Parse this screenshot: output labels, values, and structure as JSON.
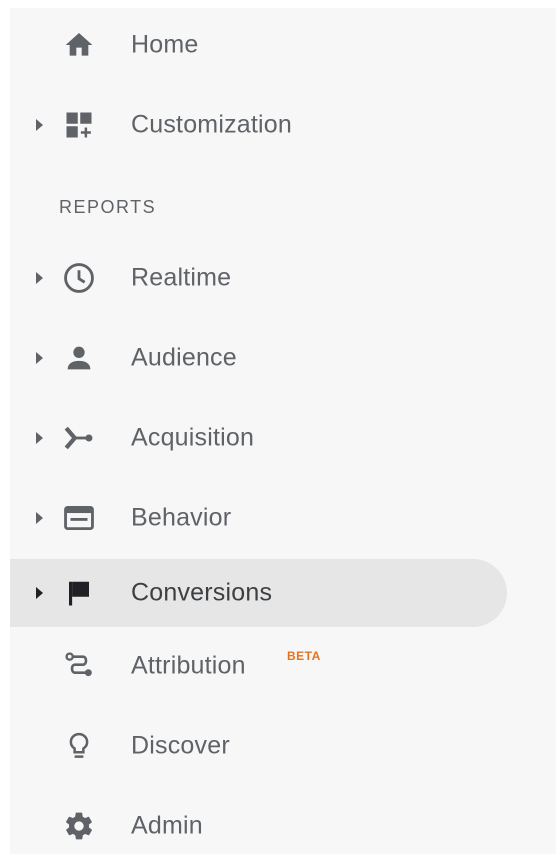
{
  "nav": {
    "home": {
      "label": "Home",
      "icon": "home-icon"
    },
    "customization": {
      "label": "Customization",
      "icon": "dashboard-add-icon"
    },
    "reports_header": "REPORTS",
    "realtime": {
      "label": "Realtime",
      "icon": "clock-icon"
    },
    "audience": {
      "label": "Audience",
      "icon": "person-icon"
    },
    "acquisition": {
      "label": "Acquisition",
      "icon": "merge-icon"
    },
    "behavior": {
      "label": "Behavior",
      "icon": "web-window-icon"
    },
    "conversions": {
      "label": "Conversions",
      "icon": "flag-icon",
      "active": true
    },
    "attribution": {
      "label": "Attribution",
      "badge": "BETA",
      "icon": "route-icon"
    },
    "discover": {
      "label": "Discover",
      "icon": "lightbulb-icon"
    },
    "admin": {
      "label": "Admin",
      "icon": "gear-icon"
    }
  },
  "colors": {
    "sidebar_bg": "#f7f7f7",
    "active_bg": "#e6e6e6",
    "icon": "#5f6368",
    "active_icon": "#202124",
    "text": "#5f6368",
    "beta": "#e8711c"
  }
}
